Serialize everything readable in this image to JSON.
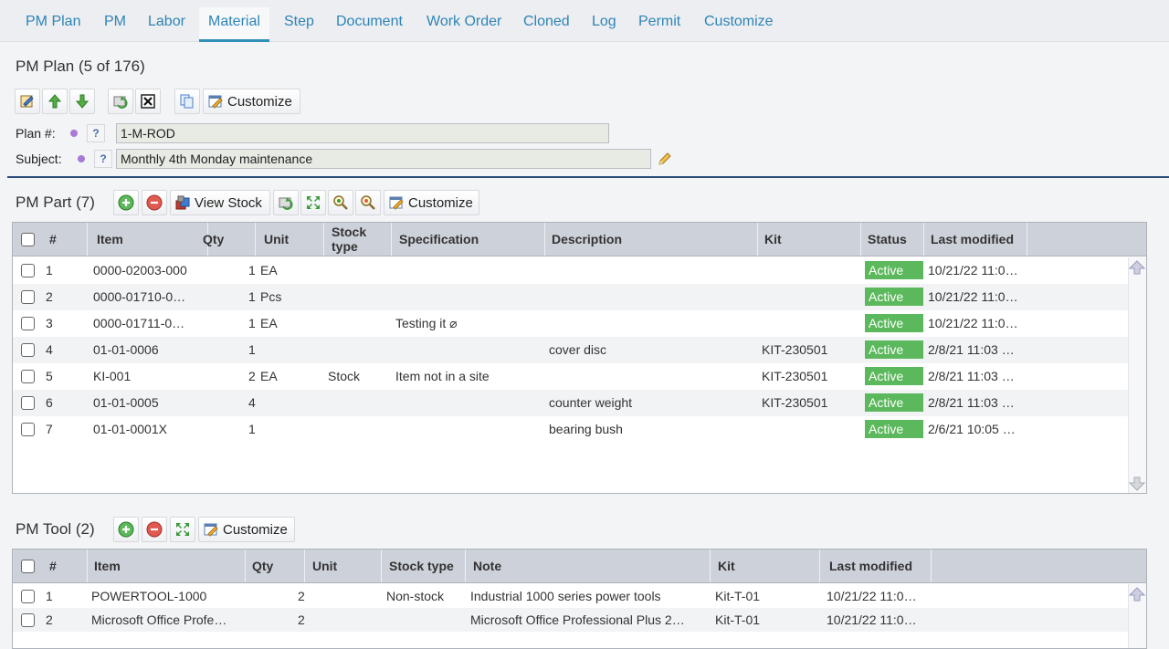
{
  "tabs": [
    {
      "label": "PM Plan",
      "active": false
    },
    {
      "label": "PM",
      "active": false
    },
    {
      "label": "Labor",
      "active": false
    },
    {
      "label": "Material",
      "active": true
    },
    {
      "label": "Step",
      "active": false
    },
    {
      "label": "Document",
      "active": false
    },
    {
      "label": "Work Order",
      "active": false
    },
    {
      "label": "Cloned",
      "active": false
    },
    {
      "label": "Log",
      "active": false
    },
    {
      "label": "Permit",
      "active": false
    },
    {
      "label": "Customize",
      "active": false
    }
  ],
  "plan": {
    "title": "PM Plan (5 of 176)",
    "toolbar": {
      "customize_label": "Customize"
    },
    "fields": {
      "plan_no_label": "Plan #:",
      "plan_no_value": "1-M-ROD",
      "subject_label": "Subject:",
      "subject_value": "Monthly 4th Monday maintenance",
      "help_glyph": "?"
    }
  },
  "parts": {
    "title": "PM Part (7)",
    "toolbar": {
      "view_stock_label": "View Stock",
      "customize_label": "Customize"
    },
    "columns": [
      "#",
      "Item",
      "Qty",
      "Unit",
      "Stock type",
      "Specification",
      "Description",
      "Kit",
      "Status",
      "Last modified"
    ],
    "rows": [
      {
        "num": "1",
        "item": "0000-02003-000",
        "qty": "1",
        "unit": "EA",
        "stock_type": "",
        "spec": "",
        "description": "",
        "kit": "",
        "status": "Active",
        "modified": "10/21/22 11:0…"
      },
      {
        "num": "2",
        "item": "0000-01710-0…",
        "qty": "1",
        "unit": "Pcs",
        "stock_type": "",
        "spec": "",
        "description": "",
        "kit": "",
        "status": "Active",
        "modified": "10/21/22 11:0…"
      },
      {
        "num": "3",
        "item": "0000-01711-0…",
        "qty": "1",
        "unit": "EA",
        "stock_type": "",
        "spec": "Testing it ⌀",
        "description": "",
        "kit": "",
        "status": "Active",
        "modified": "10/21/22 11:0…"
      },
      {
        "num": "4",
        "item": "01-01-0006",
        "qty": "1",
        "unit": "",
        "stock_type": "",
        "spec": "",
        "description": "cover disc",
        "kit": "KIT-230501",
        "status": "Active",
        "modified": "2/8/21 11:03 …"
      },
      {
        "num": "5",
        "item": "KI-001",
        "qty": "2",
        "unit": "EA",
        "stock_type": "Stock",
        "spec": "Item not in a site",
        "description": "",
        "kit": "KIT-230501",
        "status": "Active",
        "modified": "2/8/21 11:03 …"
      },
      {
        "num": "6",
        "item": "01-01-0005",
        "qty": "4",
        "unit": "",
        "stock_type": "",
        "spec": "",
        "description": "counter weight",
        "kit": "KIT-230501",
        "status": "Active",
        "modified": "2/8/21 11:03 …"
      },
      {
        "num": "7",
        "item": "01-01-0001X",
        "qty": "1",
        "unit": "",
        "stock_type": "",
        "spec": "",
        "description": "bearing bush",
        "kit": "",
        "status": "Active",
        "modified": "2/6/21 10:05 …"
      }
    ]
  },
  "tools": {
    "title": "PM Tool (2)",
    "toolbar": {
      "customize_label": "Customize"
    },
    "columns": [
      "#",
      "Item",
      "Qty",
      "Unit",
      "Stock type",
      "Note",
      "Kit",
      "Last modified"
    ],
    "rows": [
      {
        "num": "1",
        "item": "POWERTOOL-1000",
        "qty": "2",
        "unit": "",
        "stock_type": "Non-stock",
        "note": "Industrial 1000 series power tools",
        "kit": "Kit-T-01",
        "modified": "10/21/22 11:0…"
      },
      {
        "num": "2",
        "item": "Microsoft Office Profe…",
        "qty": "2",
        "unit": "",
        "stock_type": "",
        "note": "Microsoft Office Professional Plus 2…",
        "kit": "Kit-T-01",
        "modified": "10/21/22 11:0…"
      }
    ]
  },
  "colors": {
    "accent": "#2f84b6",
    "active_badge": "#5cb85c",
    "header_bg": "#cdd1d9",
    "divider": "#2b4b78"
  }
}
